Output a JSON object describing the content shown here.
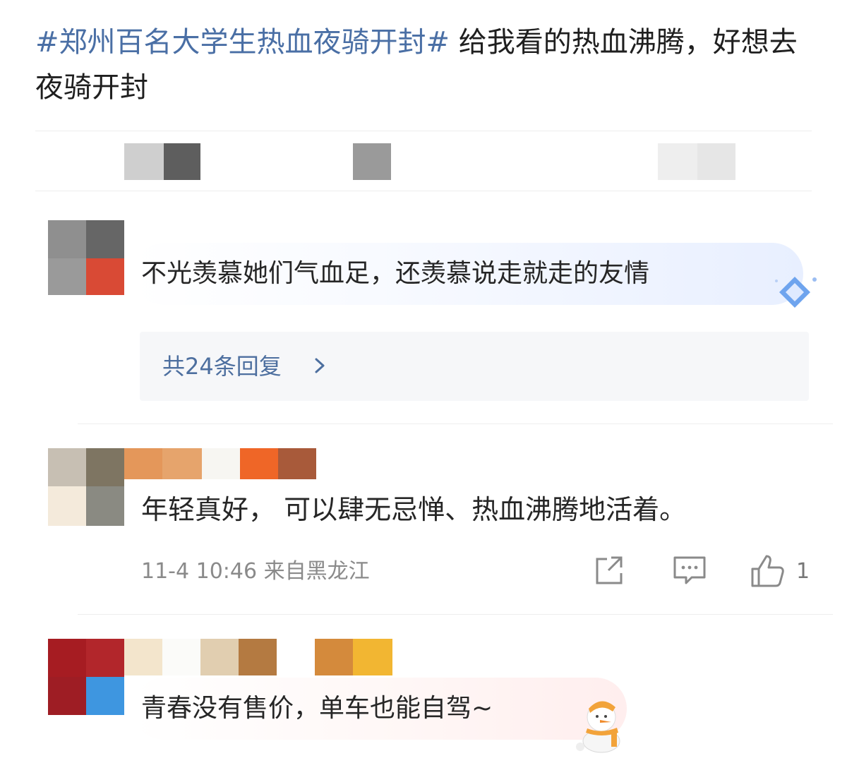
{
  "post": {
    "hashtag": "#郑州百名大学生热血夜骑开封#",
    "text": " 给我看的热血沸腾，好想去夜骑开封"
  },
  "comments": [
    {
      "text": "不光羡慕她们气血足，还羡慕说走就走的友情",
      "replies_label": "共24条回复"
    },
    {
      "text": "年轻真好，  可以肆无忌惮、热血沸腾地活着。",
      "time": "11-4 10:46",
      "location": "来自黑龙江",
      "likes": "1"
    },
    {
      "text": "青春没有售价，单车也能自驾~"
    }
  ],
  "colors": {
    "hashtag": "#4a6fa5",
    "reply_link": "#4d6f9f",
    "icon": "#8a8a8a"
  },
  "icons": {
    "share": "share-icon",
    "comment": "comment-icon",
    "like": "thumbs-up-icon",
    "badge": "diamond-badge-icon",
    "sticker": "snowman-sticker-icon",
    "chevron": "chevron-right-icon"
  }
}
